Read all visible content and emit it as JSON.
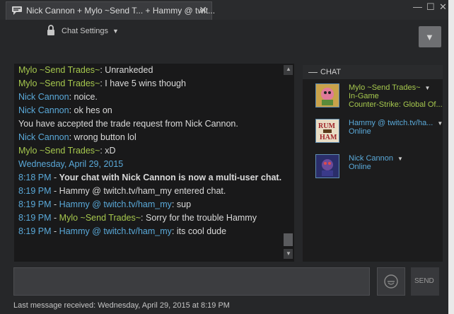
{
  "tab": {
    "title": "Nick Cannon + Mylo ~Send T... + Hammy @ twit...",
    "close": "✕"
  },
  "window_controls": {
    "minimize": "—",
    "maximize": "☐",
    "close": "✕"
  },
  "chat_settings": {
    "label": "Chat Settings",
    "caret": "▼"
  },
  "menu_button": {
    "glyph": "▼"
  },
  "messages": [
    {
      "name": "Mylo ~Send Trades~",
      "name_color": "green",
      "text": ": Unrankeded"
    },
    {
      "name": "Mylo ~Send Trades~",
      "name_color": "green",
      "text": ": I have 5 wins though"
    },
    {
      "name": "Nick Cannon",
      "name_color": "blue",
      "text": ": noice."
    },
    {
      "name": "Nick Cannon",
      "name_color": "blue",
      "text": ": ok hes on"
    },
    {
      "text": "You have accepted the trade request from Nick Cannon."
    },
    {
      "name": "Nick Cannon",
      "name_color": "blue",
      "text": ": wrong button lol"
    },
    {
      "name": "Mylo ~Send Trades~",
      "name_color": "green",
      "text": ": xD"
    },
    {
      "date": "Wednesday, April 29, 2015"
    },
    {
      "time": "8:18 PM",
      "sep": " - ",
      "bold_text": "Your chat with Nick Cannon is now a multi-user chat."
    },
    {
      "time": "8:19 PM",
      "sep": " - ",
      "text": "Hammy @ twitch.tv/ham_my entered chat."
    },
    {
      "time": "8:19 PM",
      "sep": " - ",
      "name": "Hammy @ twitch.tv/ham_my",
      "name_color": "blue",
      "text": ": sup"
    },
    {
      "time": "8:19 PM",
      "sep": " - ",
      "name": "Mylo ~Send Trades~",
      "name_color": "green",
      "text": ": Sorry for the trouble Hammy"
    },
    {
      "time": "8:19 PM",
      "sep": " - ",
      "name": "Hammy @ twitch.tv/ham_my",
      "name_color": "blue",
      "text": ": its cool dude"
    }
  ],
  "friends_panel": {
    "header": "CHAT",
    "collapse_glyph": "—",
    "friends": [
      {
        "name": "Mylo ~Send Trades~",
        "status": "In-Game",
        "game": "Counter-Strike: Global Of...",
        "color": "#a6c84e"
      },
      {
        "name": "Hammy @ twitch.tv/ha...",
        "status": "Online",
        "game": "",
        "color": "#5aa9d9"
      },
      {
        "name": "Nick Cannon",
        "status": "Online",
        "game": "",
        "color": "#5aa9d9"
      }
    ],
    "caret": "▼"
  },
  "input": {
    "value": "",
    "placeholder": ""
  },
  "send_button": {
    "label": "SEND"
  },
  "status_line": "Last message received: Wednesday, April 29, 2015 at 8:19 PM",
  "colors": {
    "green": "#a6c84e",
    "blue": "#5aa9d9",
    "background": "#262729"
  }
}
